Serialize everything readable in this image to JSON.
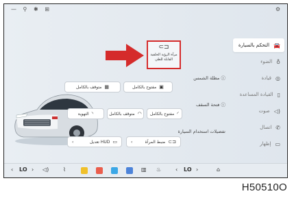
{
  "status": {
    "left_icons": [
      "—",
      "⚲",
      "✱",
      "⊞"
    ],
    "right_icon": "⚙"
  },
  "sidebar": {
    "items": [
      {
        "label": "التحكم بالسيارة",
        "icon": "car-icon",
        "active": true
      },
      {
        "label": "الضوء",
        "icon": "lightbulb-icon"
      },
      {
        "label": "قيادة",
        "icon": "steering-icon"
      },
      {
        "label": "القيادة المساعدة",
        "icon": "assist-icon"
      },
      {
        "label": "صوت",
        "icon": "speaker-icon"
      },
      {
        "label": "اتصال",
        "icon": "phone-icon"
      },
      {
        "label": "إظهار",
        "icon": "display-icon"
      }
    ]
  },
  "mirror_tile": {
    "title_line1": "مرآة الرؤية الخلفية",
    "title_line2": "القابلة للطي"
  },
  "sunshade": {
    "title": "مظلة الشمس",
    "options": [
      "مفتوح بالكامل",
      "متوقف بالكامل"
    ]
  },
  "sunroof": {
    "title": "فتحة السقف",
    "options": [
      "مفتوح بالكامل",
      "متوقف بالكامل",
      "التهوية"
    ]
  },
  "vehicle_prefs": {
    "title": "تفضيلات استخدام السيارة",
    "options": [
      "ضبط المرآة",
      "تعديل HUD"
    ]
  },
  "dock": {
    "left_temp": "LO",
    "right_temp": "LO"
  },
  "figure_code": "H50510O",
  "colors": {
    "highlight": "#d52b2b",
    "arrow": "#d52b2b"
  }
}
